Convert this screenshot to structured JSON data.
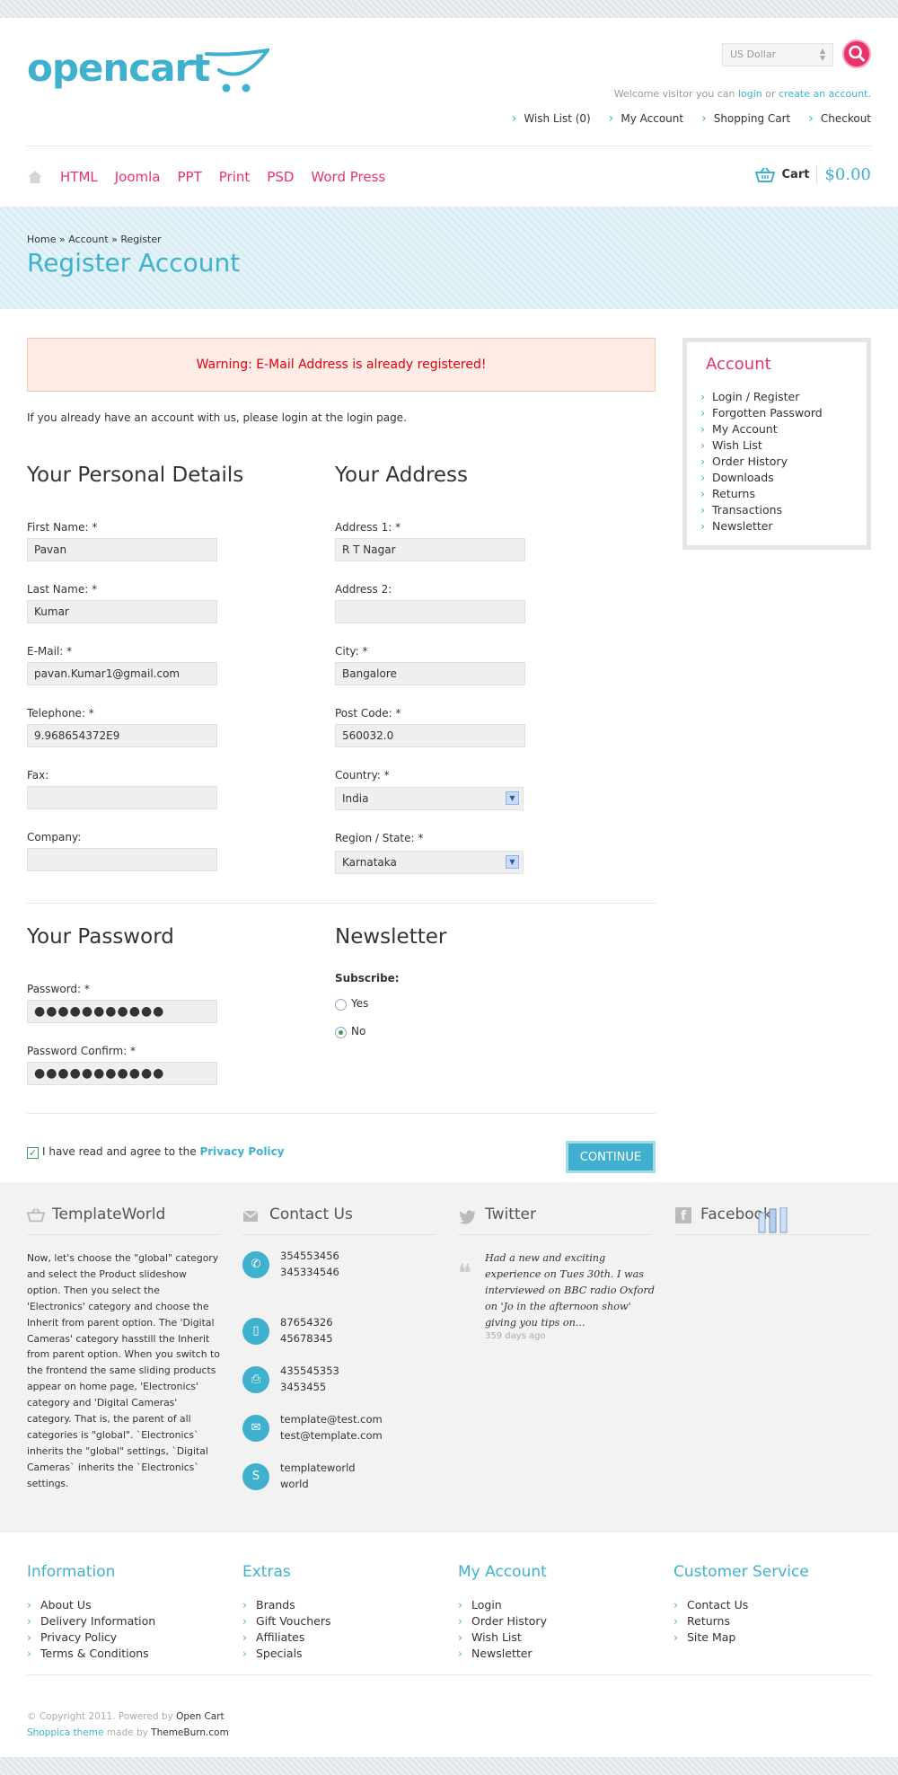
{
  "header": {
    "logo_text": "opencart",
    "currency": "US Dollar",
    "welcome_prefix": "Welcome visitor you can",
    "welcome_login": "login",
    "welcome_or": "or",
    "welcome_create": "create an account.",
    "links": [
      "Wish List (0)",
      "My Account",
      "Shopping Cart",
      "Checkout"
    ]
  },
  "nav": {
    "items": [
      "HTML",
      "Joomla",
      "PPT",
      "Print",
      "PSD",
      "Word Press"
    ],
    "cart_label": "Cart",
    "cart_amount": "$0.00"
  },
  "title_band": {
    "breadcrumb": [
      "Home",
      "Account",
      "Register"
    ],
    "breadcrumb_sep": "»",
    "title": "Register Account"
  },
  "warning": "Warning: E-Mail Address is already registered!",
  "intro": "If you already have an account with us, please login at the login page.",
  "personal": {
    "title": "Your Personal Details",
    "fields": [
      {
        "label": "First Name: *",
        "value": "Pavan"
      },
      {
        "label": "Last Name: *",
        "value": "Kumar"
      },
      {
        "label": "E-Mail: *",
        "value": "pavan.Kumar1@gmail.com"
      },
      {
        "label": "Telephone: *",
        "value": "9.968654372E9"
      },
      {
        "label": "Fax:",
        "value": ""
      },
      {
        "label": "Company:",
        "value": ""
      }
    ]
  },
  "address": {
    "title": "Your Address",
    "fields": [
      {
        "label": "Address 1: *",
        "value": "R T Nagar"
      },
      {
        "label": "Address 2:",
        "value": ""
      },
      {
        "label": "City: *",
        "value": "Bangalore"
      },
      {
        "label": "Post Code: *",
        "value": "560032.0"
      },
      {
        "label": "Country: *",
        "value": "India"
      },
      {
        "label": "Region / State: *",
        "value": "Karnataka"
      }
    ]
  },
  "password": {
    "title": "Your Password",
    "password_label": "Password: *",
    "password_value": "●●●●●●●●●●●",
    "confirm_label": "Password Confirm: *",
    "confirm_value": "●●●●●●●●●●●"
  },
  "newsletter": {
    "title": "Newsletter",
    "subscribe_label": "Subscribe:",
    "yes": "Yes",
    "no": "No",
    "selected": "No"
  },
  "agree": {
    "text": "I have read and agree to the",
    "link": "Privacy Policy",
    "checked": true
  },
  "continue_label": "CONTINUE",
  "sidebar": {
    "title": "Account",
    "items": [
      "Login / Register",
      "Forgotten Password",
      "My Account",
      "Wish List",
      "Order History",
      "Downloads",
      "Returns",
      "Transactions",
      "Newsletter"
    ]
  },
  "footer": {
    "about": {
      "title": "TemplateWorld",
      "text": "Now, let's choose the \"global\" category and select the Product slideshow option. Then you select the 'Electronics' category and choose the Inherit from parent option. The 'Digital Cameras' category hasstill the Inherit from parent option. When you switch to the frontend the same sliding products appear on home page, 'Electronics' category and 'Digital Cameras' category. That is, the parent of all categories is \"global\". `Electronics` inherits the \"global\" settings, `Digital Cameras` inherits the `Electronics` settings."
    },
    "contact": {
      "title": "Contact Us",
      "items": [
        {
          "icon": "phone-icon",
          "lines": [
            "354553456",
            "345334546"
          ]
        },
        {
          "icon": "mobile-icon",
          "lines": [
            "87654326",
            "45678345"
          ]
        },
        {
          "icon": "fax-icon",
          "lines": [
            "435545353",
            "3453455"
          ]
        },
        {
          "icon": "mail-icon",
          "lines": [
            "template@test.com",
            "test@template.com"
          ]
        },
        {
          "icon": "skype-icon",
          "lines": [
            "templateworld",
            "world"
          ]
        }
      ]
    },
    "twitter": {
      "title": "Twitter",
      "tweet": "Had a new and exciting experience on Tues 30th. I was interviewed on BBC radio Oxford on 'Jo in the afternoon show' giving you tips on...",
      "time": "359 days ago"
    },
    "facebook": {
      "title": "Facebook"
    }
  },
  "footer_links": {
    "information": {
      "title": "Information",
      "items": [
        "About Us",
        "Delivery Information",
        "Privacy Policy",
        "Terms & Conditions"
      ]
    },
    "extras": {
      "title": "Extras",
      "items": [
        "Brands",
        "Gift Vouchers",
        "Affiliates",
        "Specials"
      ]
    },
    "my_account": {
      "title": "My Account",
      "items": [
        "Login",
        "Order History",
        "Wish List",
        "Newsletter"
      ]
    },
    "customer_service": {
      "title": "Customer Service",
      "items": [
        "Contact Us",
        "Returns",
        "Site Map"
      ]
    }
  },
  "copyright": {
    "line1_prefix": "© Copyright 2011. Powered by",
    "line1_link": "Open Cart",
    "line2_link": "Shoppica theme",
    "line2_mid": "made by",
    "line2_author": "ThemeBurn.com"
  },
  "colors": {
    "accent": "#3fb1cf",
    "pink": "#e8336a",
    "warning_bg": "#ffece6",
    "warning_text": "#e2000e"
  }
}
